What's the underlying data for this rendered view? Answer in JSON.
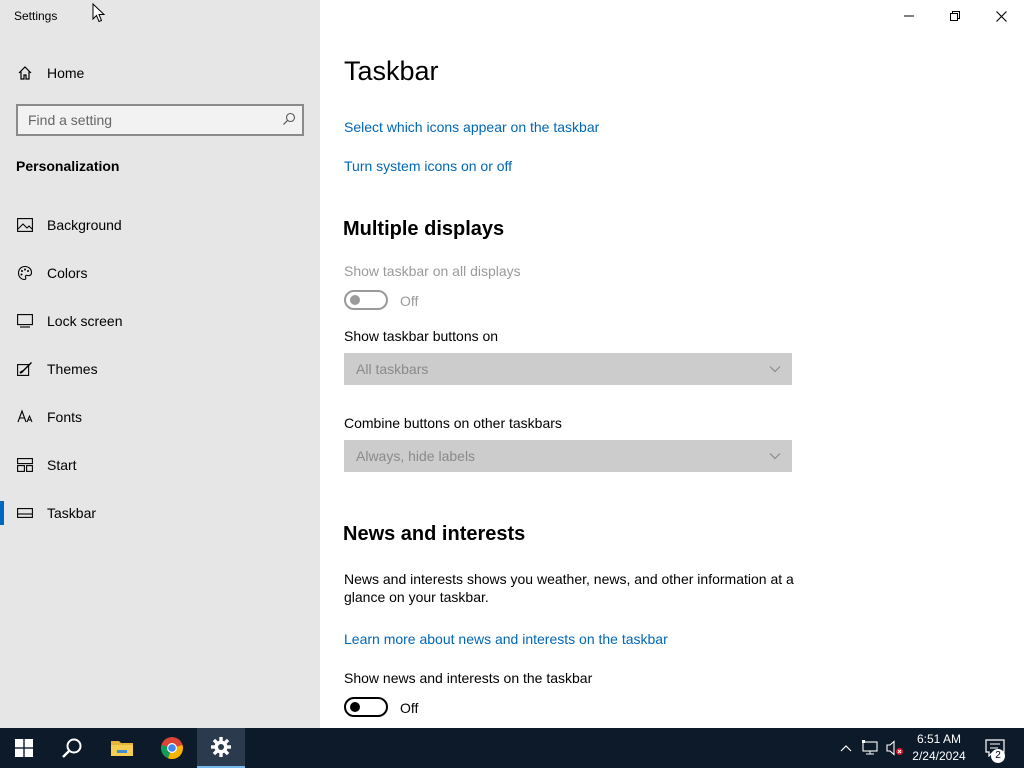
{
  "window": {
    "title": "Settings"
  },
  "sidebar": {
    "home_label": "Home",
    "search_placeholder": "Find a setting",
    "section_title": "Personalization",
    "items": [
      {
        "label": "Background",
        "icon": "picture-icon"
      },
      {
        "label": "Colors",
        "icon": "palette-icon"
      },
      {
        "label": "Lock screen",
        "icon": "lock-screen-icon"
      },
      {
        "label": "Themes",
        "icon": "brush-icon"
      },
      {
        "label": "Fonts",
        "icon": "font-icon"
      },
      {
        "label": "Start",
        "icon": "start-icon"
      },
      {
        "label": "Taskbar",
        "icon": "taskbar-icon"
      }
    ],
    "selected": "Taskbar"
  },
  "main": {
    "title": "Taskbar",
    "link_select_icons": "Select which icons appear on the taskbar",
    "link_system_icons": "Turn system icons on or off",
    "multiple_displays": {
      "heading": "Multiple displays",
      "show_all_label": "Show taskbar on all displays",
      "show_all_state": "Off",
      "buttons_on_label": "Show taskbar buttons on",
      "buttons_on_value": "All taskbars",
      "combine_label": "Combine buttons on other taskbars",
      "combine_value": "Always, hide labels"
    },
    "news": {
      "heading": "News and interests",
      "description": "News and interests shows you weather, news, and other information at a glance on your taskbar.",
      "learn_more": "Learn more about news and interests on the taskbar",
      "show_label": "Show news and interests on the taskbar",
      "show_state": "Off"
    }
  },
  "taskbar": {
    "time": "6:51 AM",
    "date": "2/24/2024",
    "notification_count": "2",
    "apps": [
      "start-icon",
      "search-icon",
      "file-explorer-icon",
      "chrome-icon",
      "settings-gear-icon"
    ]
  },
  "colors": {
    "accent": "#0067c0",
    "link": "#0067b8",
    "sidebar_bg": "#e6e6e6",
    "taskbar_bg": "#0c1a2a"
  }
}
